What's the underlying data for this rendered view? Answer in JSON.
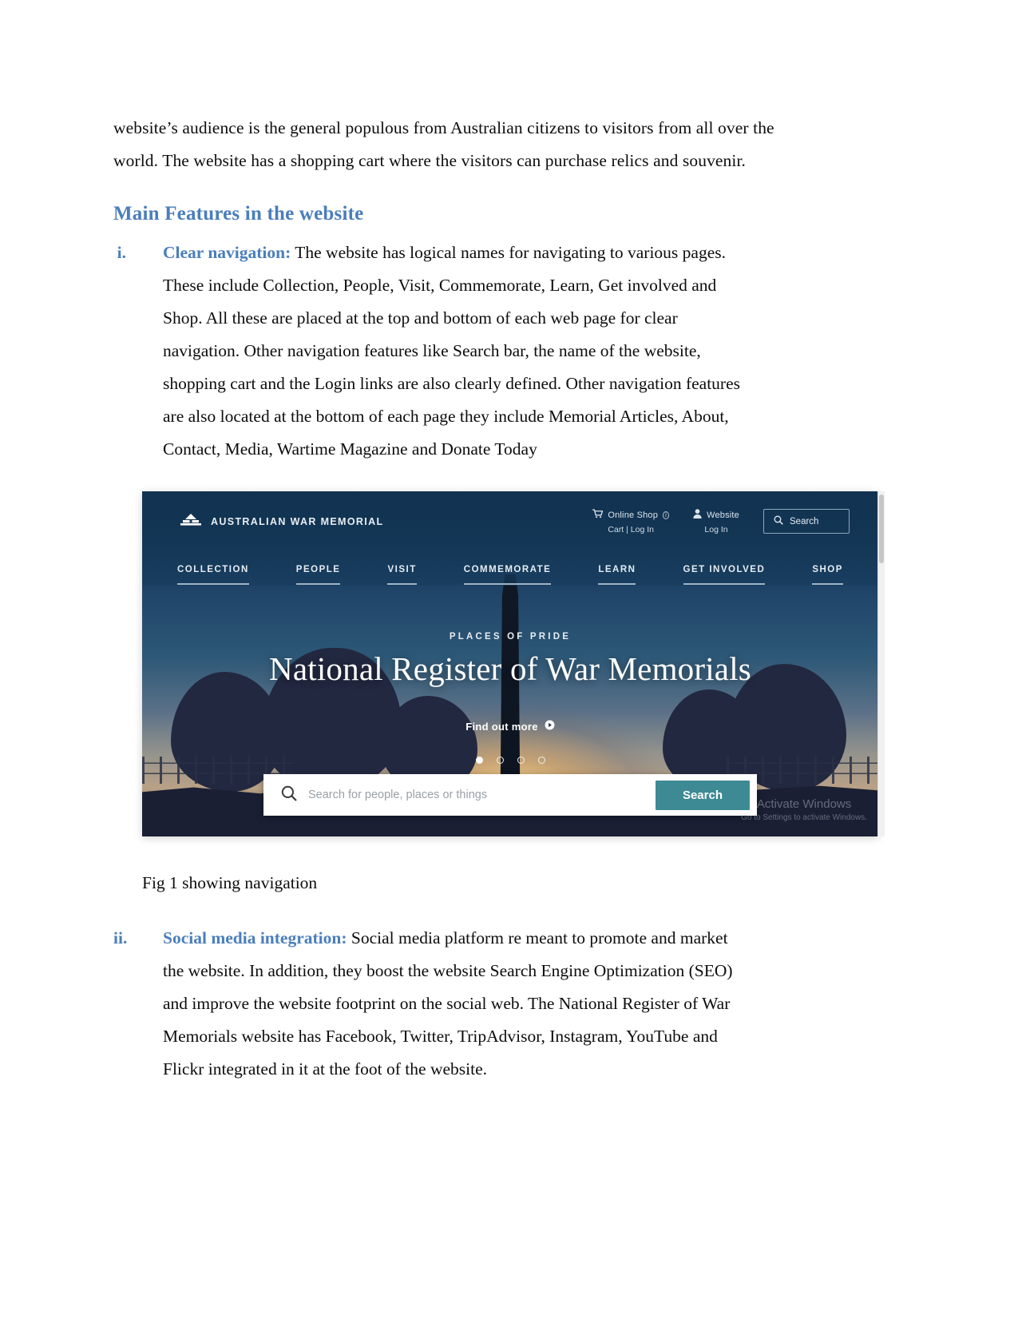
{
  "document": {
    "intro_paragraph": {
      "lines": [
        "website’s audience is the general populous from Australian citizens to visitors from all over the",
        "world. The website has a shopping cart where the visitors can purchase relics and souvenir."
      ]
    },
    "section_heading": "Main Features in the website",
    "list": [
      {
        "marker": "i.",
        "lead": "Clear navigation:",
        "lines": [
          " The website has logical names for navigating to various pages.",
          "These include Collection, People, Visit, Commemorate, Learn, Get involved and",
          "Shop. All these are placed at the top and bottom of each web page for clear",
          "navigation. Other navigation features like Search bar, the name of the website,",
          "shopping cart and the Login links are also clearly defined. Other navigation features",
          "are also located at the bottom of each page they include Memorial Articles, About,",
          "Contact, Media, Wartime Magazine and Donate Today"
        ]
      },
      {
        "marker": "ii.",
        "lead": "Social media integration:",
        "lines": [
          " Social media platform re meant to promote and market",
          "the website. In addition, they boost the website Search Engine Optimization (SEO)",
          "and improve the website footprint on the social web. The National Register of War",
          "Memorials website has Facebook, Twitter, TripAdvisor, Instagram, YouTube and",
          "Flickr integrated in it at the foot of the website."
        ]
      }
    ],
    "figure_caption": "Fig 1 showing navigation"
  },
  "screenshot": {
    "brand": {
      "logo_icon": "memorial-building-icon",
      "name": "AUSTRALIAN WAR MEMORIAL"
    },
    "utility": [
      {
        "icon": "cart-icon",
        "top_label": "Online Shop",
        "info_marker": "ⓘ",
        "bottom_label": "Cart | Log In"
      },
      {
        "icon": "person-icon",
        "top_label": "Website",
        "bottom_label": "Log In"
      }
    ],
    "search_box": {
      "icon": "search-icon",
      "label": "Search"
    },
    "main_nav": [
      "COLLECTION",
      "PEOPLE",
      "VISIT",
      "COMMEMORATE",
      "LEARN",
      "GET INVOLVED",
      "SHOP"
    ],
    "hero": {
      "kicker": "PLACES OF PRIDE",
      "title": "National Register of War Memorials",
      "cta": "Find out more",
      "cta_icon": "arrow-circle-right-icon",
      "carousel_dots": 4,
      "carousel_active_index": 0
    },
    "hero_search": {
      "icon": "search-icon",
      "placeholder": "Search for people, places or things",
      "button_label": "Search",
      "button_color": "#3e8a94"
    },
    "watermark": {
      "line1": "Activate Windows",
      "line2": "Go to Settings to activate Windows."
    },
    "colors": {
      "heading_blue": "#4a7ebb",
      "nav_navy": "#113250",
      "teal_button": "#3e8a94"
    }
  }
}
